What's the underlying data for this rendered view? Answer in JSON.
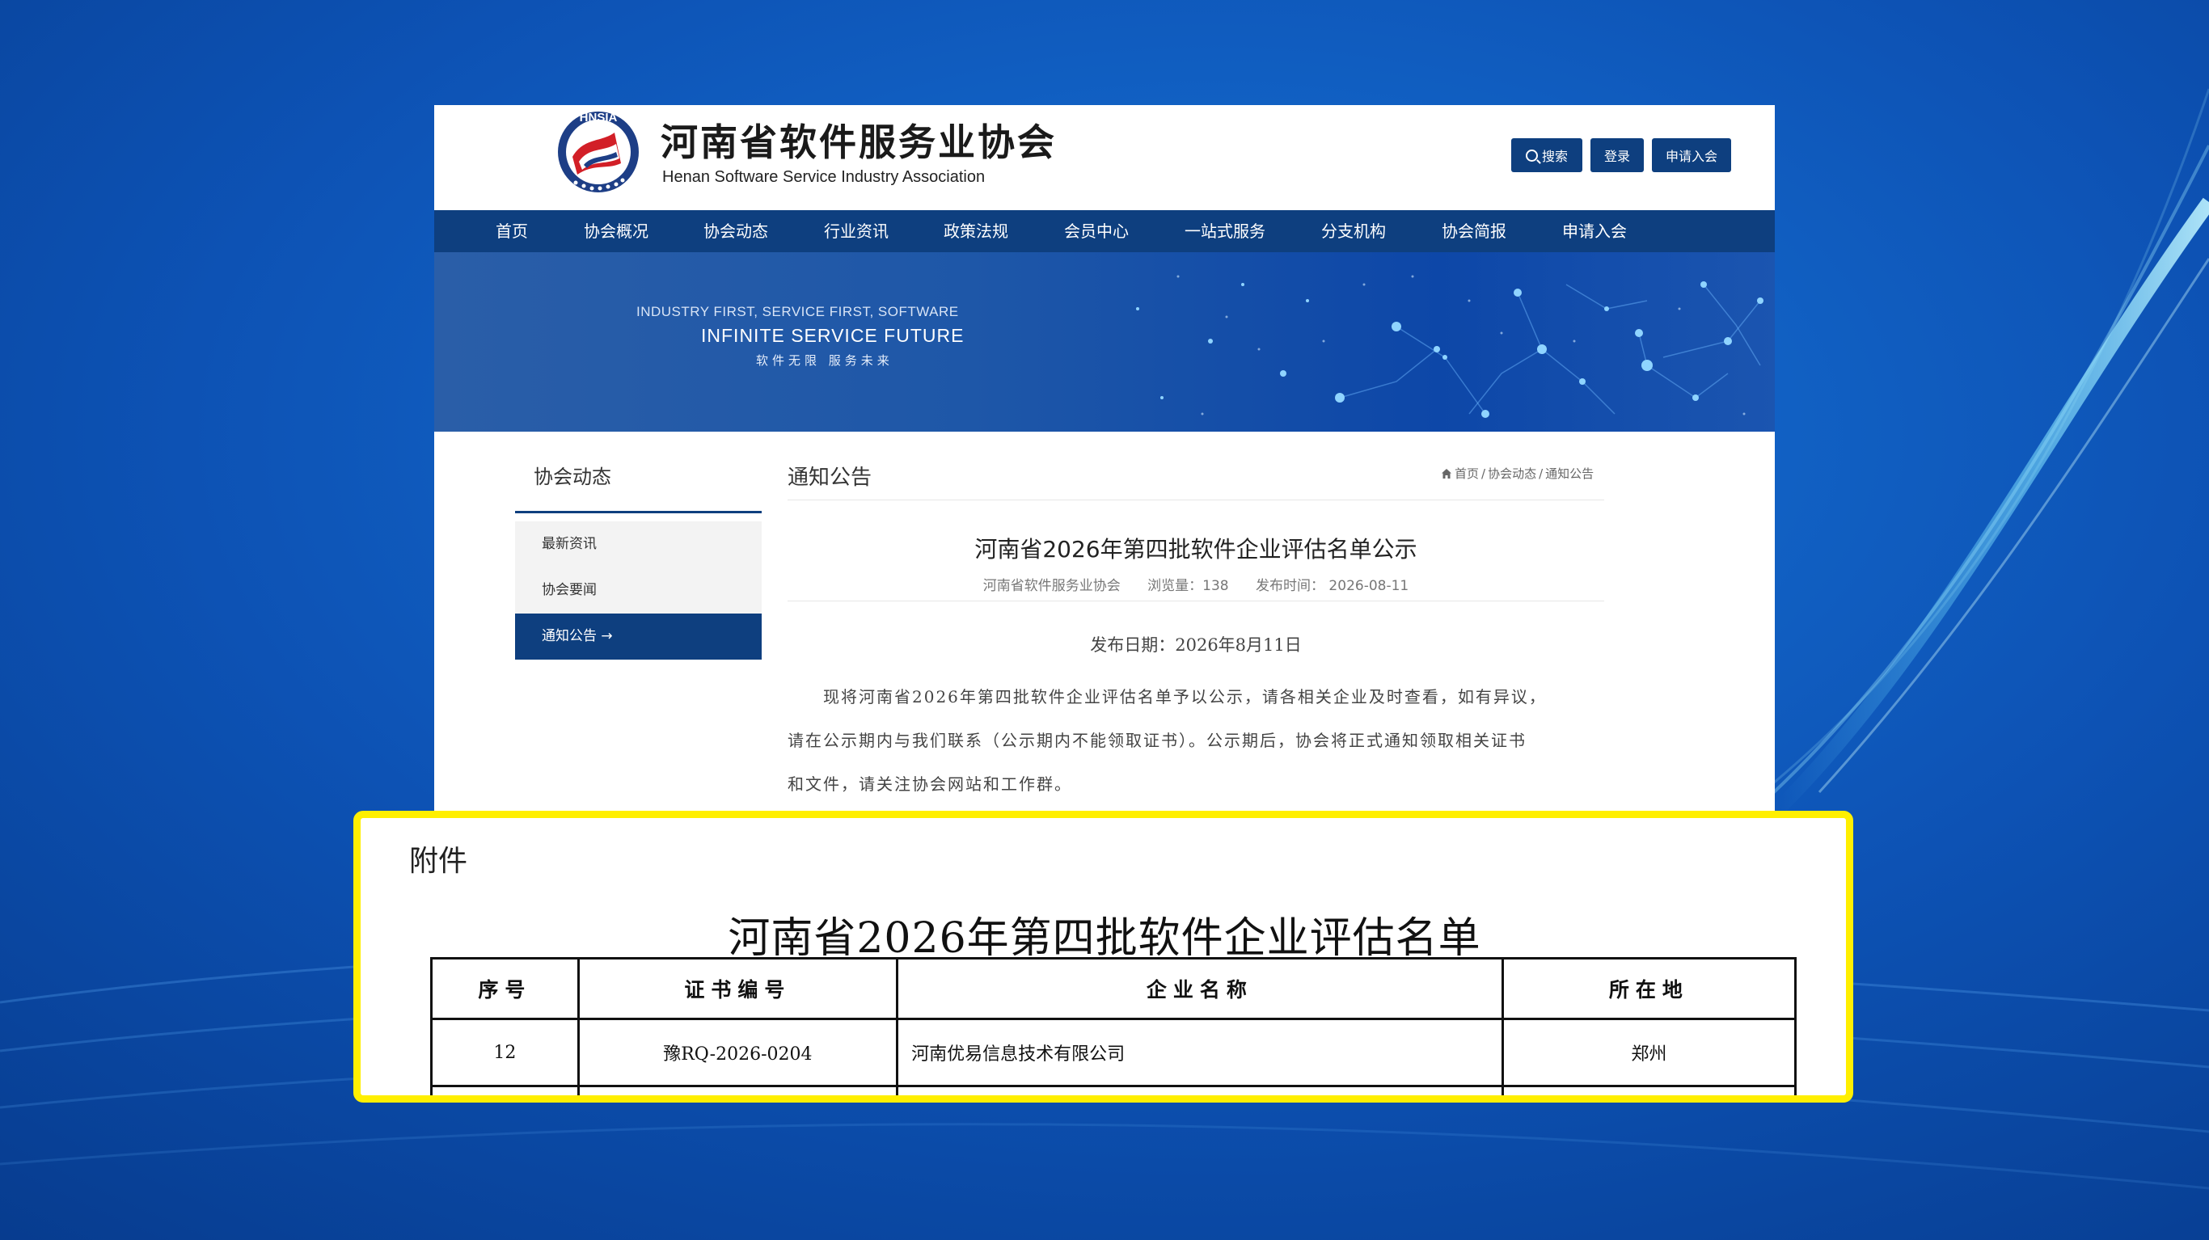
{
  "header": {
    "logo_text": "HNSIA",
    "site_name": "河南省软件服务业协会",
    "site_name_en": "Henan Software Service Industry Association",
    "search_label": "搜索",
    "login_label": "登录",
    "apply_label": "申请入会"
  },
  "nav": {
    "items": [
      "首页",
      "协会概况",
      "协会动态",
      "行业资讯",
      "政策法规",
      "会员中心",
      "一站式服务",
      "分支机构",
      "协会简报",
      "申请入会"
    ]
  },
  "banner": {
    "slogan_line1": "INDUSTRY FIRST, SERVICE FIRST, SOFTWARE",
    "slogan_line2": "INFINITE SERVICE FUTURE",
    "slogan_line3": "软件无限  服务未来"
  },
  "sidebar": {
    "title": "协会动态",
    "items": [
      {
        "label": "最新资讯"
      },
      {
        "label": "协会要闻"
      },
      {
        "label": "通知公告"
      }
    ],
    "active_arrow": "→"
  },
  "main": {
    "section_title": "通知公告",
    "breadcrumb": {
      "home": "首页",
      "level1": "协会动态",
      "level2": "通知公告",
      "separator": "/"
    },
    "article": {
      "title": "河南省2026年第四批软件企业评估名单公示",
      "author": "河南省软件服务业协会",
      "views": "浏览量：138",
      "publish_time": "发布时间：  2026-08-11",
      "publish_date": "发布日期：2026年8月11日",
      "body_lines": [
        "　　现将河南省2026年第四批软件企业评估名单予以公示，请各相关企业及时查看，如有异议，",
        "请在公示期内与我们联系（公示期内不能领取证书）。公示期后，协会将正式通知领取相关证书",
        "和文件，请关注协会网站和工作群。"
      ]
    }
  },
  "attachment": {
    "label": "附件",
    "doc_title": "河南省2026年第四批软件企业评估名单",
    "columns": [
      "序号",
      "证书编号",
      "企业名称",
      "所在地"
    ],
    "rows": [
      {
        "no": "12",
        "cert": "豫RQ-2026-0204",
        "company": "河南优易信息技术有限公司",
        "city": "郑州"
      }
    ]
  },
  "colors": {
    "navy": "#0e3f7f",
    "highlight": "#ffef00",
    "backdrop": "#0b4aa6"
  }
}
